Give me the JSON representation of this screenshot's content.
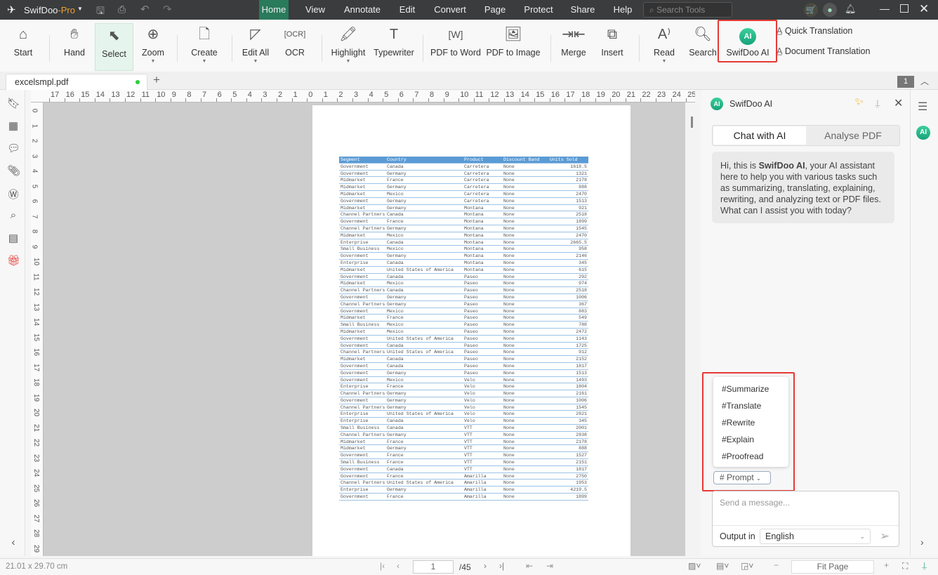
{
  "titlebar": {
    "app_name": "SwifDoo",
    "app_edition": "-Pro",
    "menus": [
      "Home",
      "View",
      "Annotate",
      "Edit",
      "Convert",
      "Page",
      "Protect",
      "Share",
      "Help"
    ],
    "active_menu": "Home",
    "search_placeholder": "Search Tools"
  },
  "toolbar": {
    "tools": [
      "Start",
      "Hand",
      "Select",
      "Zoom",
      "Create",
      "Edit All",
      "OCR",
      "Highlight",
      "Typewriter",
      "PDF to Word",
      "PDF to Image",
      "Merge",
      "Insert",
      "Read",
      "Search",
      "SwifDoo AI"
    ],
    "active_tool": "Select",
    "quick_translation": "Quick Translation",
    "document_translation": "Document Translation",
    "ai_badge": "AI"
  },
  "tabs": {
    "file": "excelsmpl.pdf",
    "add": "+",
    "page_badge": "1"
  },
  "ruler": {
    "h": [
      "17",
      "16",
      "15",
      "14",
      "13",
      "12",
      "11",
      "10",
      "9",
      "8",
      "7",
      "6",
      "5",
      "4",
      "3",
      "2",
      "1",
      "0",
      "1",
      "2",
      "3",
      "4",
      "5",
      "6",
      "7",
      "8",
      "9",
      "10",
      "11",
      "12",
      "13",
      "14",
      "15",
      "16",
      "17",
      "18",
      "19",
      "20",
      "21",
      "22",
      "23",
      "24",
      "25"
    ],
    "v": [
      "0",
      "1",
      "2",
      "3",
      "4",
      "5",
      "6",
      "7",
      "8",
      "9",
      "10",
      "11",
      "12",
      "13",
      "14",
      "15",
      "16",
      "17",
      "18",
      "19",
      "20",
      "21",
      "22",
      "23",
      "24",
      "25",
      "26",
      "27",
      "28",
      "29"
    ]
  },
  "document": {
    "columns": [
      "Segment",
      "Country",
      "Product",
      "Discount Band",
      "Units Sold"
    ],
    "rows": [
      [
        "Government",
        "Canada",
        "Carretera",
        "None",
        "1618.5"
      ],
      [
        "Government",
        "Germany",
        "Carretera",
        "None",
        "1321"
      ],
      [
        "Midmarket",
        "France",
        "Carretera",
        "None",
        "2178"
      ],
      [
        "Midmarket",
        "Germany",
        "Carretera",
        "None",
        "888"
      ],
      [
        "Midmarket",
        "Mexico",
        "Carretera",
        "None",
        "2470"
      ],
      [
        "Government",
        "Germany",
        "Carretera",
        "None",
        "1513"
      ],
      [
        "Midmarket",
        "Germany",
        "Montana",
        "None",
        "921"
      ],
      [
        "Channel Partners",
        "Canada",
        "Montana",
        "None",
        "2518"
      ],
      [
        "Government",
        "France",
        "Montana",
        "None",
        "1899"
      ],
      [
        "Channel Partners",
        "Germany",
        "Montana",
        "None",
        "1545"
      ],
      [
        "Midmarket",
        "Mexico",
        "Montana",
        "None",
        "2470"
      ],
      [
        "Enterprise",
        "Canada",
        "Montana",
        "None",
        "2665.5"
      ],
      [
        "Small Business",
        "Mexico",
        "Montana",
        "None",
        "958"
      ],
      [
        "Government",
        "Germany",
        "Montana",
        "None",
        "2146"
      ],
      [
        "Enterprise",
        "Canada",
        "Montana",
        "None",
        "345"
      ],
      [
        "Midmarket",
        "United States of America",
        "Montana",
        "None",
        "615"
      ],
      [
        "Government",
        "Canada",
        "Paseo",
        "None",
        "292"
      ],
      [
        "Midmarket",
        "Mexico",
        "Paseo",
        "None",
        "974"
      ],
      [
        "Channel Partners",
        "Canada",
        "Paseo",
        "None",
        "2518"
      ],
      [
        "Government",
        "Germany",
        "Paseo",
        "None",
        "1006"
      ],
      [
        "Channel Partners",
        "Germany",
        "Paseo",
        "None",
        "367"
      ],
      [
        "Government",
        "Mexico",
        "Paseo",
        "None",
        "883"
      ],
      [
        "Midmarket",
        "France",
        "Paseo",
        "None",
        "549"
      ],
      [
        "Small Business",
        "Mexico",
        "Paseo",
        "None",
        "788"
      ],
      [
        "Midmarket",
        "Mexico",
        "Paseo",
        "None",
        "2472"
      ],
      [
        "Government",
        "United States of America",
        "Paseo",
        "None",
        "1143"
      ],
      [
        "Government",
        "Canada",
        "Paseo",
        "None",
        "1725"
      ],
      [
        "Channel Partners",
        "United States of America",
        "Paseo",
        "None",
        "912"
      ],
      [
        "Midmarket",
        "Canada",
        "Paseo",
        "None",
        "2152"
      ],
      [
        "Government",
        "Canada",
        "Paseo",
        "None",
        "1817"
      ],
      [
        "Government",
        "Germany",
        "Paseo",
        "None",
        "1513"
      ],
      [
        "Government",
        "Mexico",
        "Velo",
        "None",
        "1493"
      ],
      [
        "Enterprise",
        "France",
        "Velo",
        "None",
        "1804"
      ],
      [
        "Channel Partners",
        "Germany",
        "Velo",
        "None",
        "2161"
      ],
      [
        "Government",
        "Germany",
        "Velo",
        "None",
        "1006"
      ],
      [
        "Channel Partners",
        "Germany",
        "Velo",
        "None",
        "1545"
      ],
      [
        "Enterprise",
        "United States of America",
        "Velo",
        "None",
        "2821"
      ],
      [
        "Enterprise",
        "Canada",
        "Velo",
        "None",
        "345"
      ],
      [
        "Small Business",
        "Canada",
        "VTT",
        "None",
        "2001"
      ],
      [
        "Channel Partners",
        "Germany",
        "VTT",
        "None",
        "2838"
      ],
      [
        "Midmarket",
        "France",
        "VTT",
        "None",
        "2178"
      ],
      [
        "Midmarket",
        "Germany",
        "VTT",
        "None",
        "888"
      ],
      [
        "Government",
        "France",
        "VTT",
        "None",
        "1527"
      ],
      [
        "Small Business",
        "France",
        "VTT",
        "None",
        "2151"
      ],
      [
        "Government",
        "Canada",
        "VTT",
        "None",
        "1817"
      ],
      [
        "Government",
        "France",
        "Amarilla",
        "None",
        "2750"
      ],
      [
        "Channel Partners",
        "United States of America",
        "Amarilla",
        "None",
        "1953"
      ],
      [
        "Enterprise",
        "Germany",
        "Amarilla",
        "None",
        "4219.5"
      ],
      [
        "Government",
        "France",
        "Amarilla",
        "None",
        "1899"
      ]
    ]
  },
  "ai_panel": {
    "title": "SwifDoo AI",
    "tabs": [
      "Chat with AI",
      "Analyse PDF"
    ],
    "active_tab": "Chat with AI",
    "greeting_pre": "Hi, this is ",
    "greeting_bold": "SwifDoo AI",
    "greeting_post": ", your AI assistant here to help you with various tasks such as summarizing, translating, explaining, rewriting, and analyzing text or PDF files. What can I assist you with today?",
    "prompts": [
      "#Summarize",
      "#Translate",
      "#Rewrite",
      "#Explain",
      "#Proofread"
    ],
    "prompt_button": "# Prompt",
    "message_placeholder": "Send a message...",
    "output_label": "Output in",
    "output_language": "English"
  },
  "status": {
    "page_size": "21.01 x 29.70 cm",
    "current_page": "1",
    "total_pages": "/45",
    "zoom_mode": "Fit Page"
  },
  "colors": {
    "accent": "#2a7a5c",
    "highlight_box": "#e53935",
    "table_header": "#5b9bd5"
  }
}
